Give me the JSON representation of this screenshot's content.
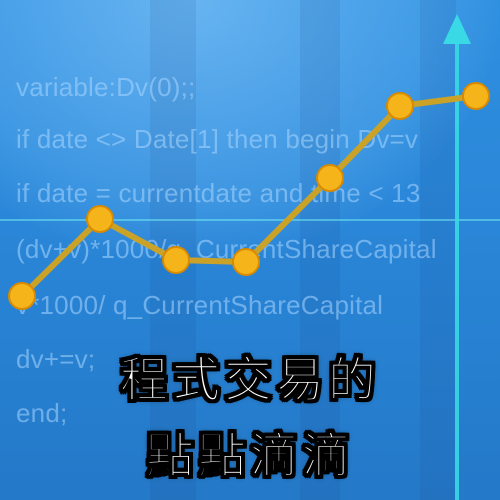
{
  "code_lines": [
    "variable:Dv(0);;",
    "if date <> Date[1] then begin Dv=v",
    "if date = currentdate and time < 13",
    "(dv+v)*1000/q_CurrentShareCapital",
    "v*1000/ q_CurrentShareCapital",
    "dv+=v;",
    "end;"
  ],
  "title": {
    "line1": "程式交易的",
    "line2": "點點滴滴"
  },
  "colors": {
    "background": "#2a86d8",
    "code_text": "#aad7ff",
    "trend_line": "#c9a227",
    "point_fill": "#f4b41a",
    "point_stroke": "#d88a00",
    "arrow": "#39d9e6",
    "title_text": "#ffffff",
    "title_outline": "#000000"
  },
  "icons": {
    "arrow": "up-arrow-icon"
  }
}
